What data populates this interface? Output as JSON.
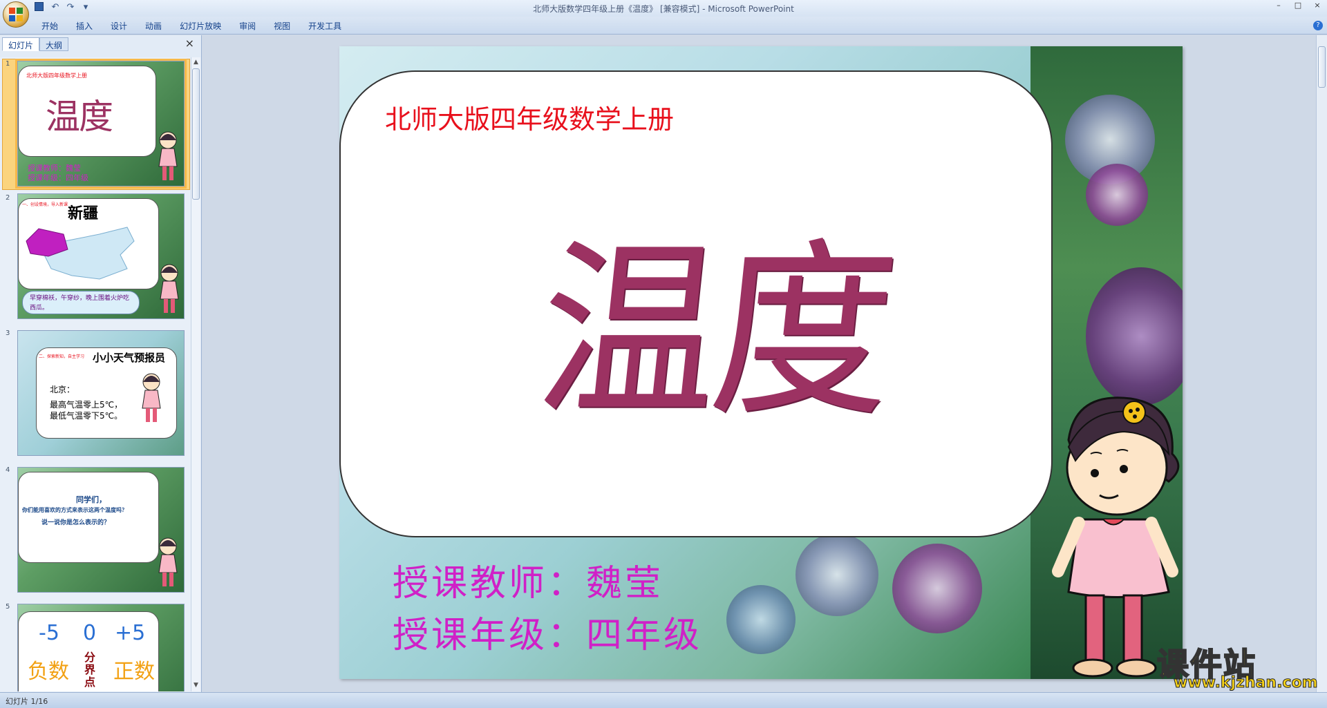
{
  "window": {
    "title": "北师大版数学四年级上册《温度》 [兼容模式] - Microsoft PowerPoint",
    "min": "–",
    "max": "□",
    "close": "×"
  },
  "ribbon": {
    "tabs": [
      "开始",
      "插入",
      "设计",
      "动画",
      "幻灯片放映",
      "审阅",
      "视图",
      "开发工具"
    ],
    "help": "?"
  },
  "panel": {
    "tabs": [
      "幻灯片",
      "大纲"
    ],
    "close": "×"
  },
  "thumbnails": [
    {
      "num": "1",
      "subtitle": "北师大版四年级数学上册",
      "title": "温度",
      "lines": [
        "授课教师：魏莹",
        "授课年级：四年级"
      ]
    },
    {
      "num": "2",
      "small": "一、创设情境，导入新课",
      "title": "新疆",
      "caption": "早穿棉袄，午穿纱，晚上围着火炉吃西瓜。"
    },
    {
      "num": "3",
      "small": "二、探索新知，自主学习",
      "title": "小小天气预报员",
      "lines": [
        "北京：",
        "最高气温零上5℃，",
        "最低气温零下5℃。"
      ]
    },
    {
      "num": "4",
      "lines": [
        "同学们，",
        "你们能用喜欢的方式来表示这两个温度吗？",
        "说一说你是怎么表示的？"
      ]
    },
    {
      "num": "5",
      "nums": [
        "-5",
        "0",
        "+5"
      ],
      "labels": [
        "负数",
        "分界点",
        "正数"
      ]
    }
  ],
  "slide": {
    "subtitle": "北师大版四年级数学上册",
    "title": "温度",
    "teacher": "授课教师：魏莹",
    "grade": "授课年级：四年级"
  },
  "watermark": {
    "title": "课件站",
    "url": "www.kjzhan.com"
  },
  "status": {
    "text": "幻灯片 1/16"
  },
  "colors": {
    "title": "#9c3262",
    "subtitle": "#e8101c",
    "teacher": "#d020c7",
    "accent": "#f6b94a"
  }
}
